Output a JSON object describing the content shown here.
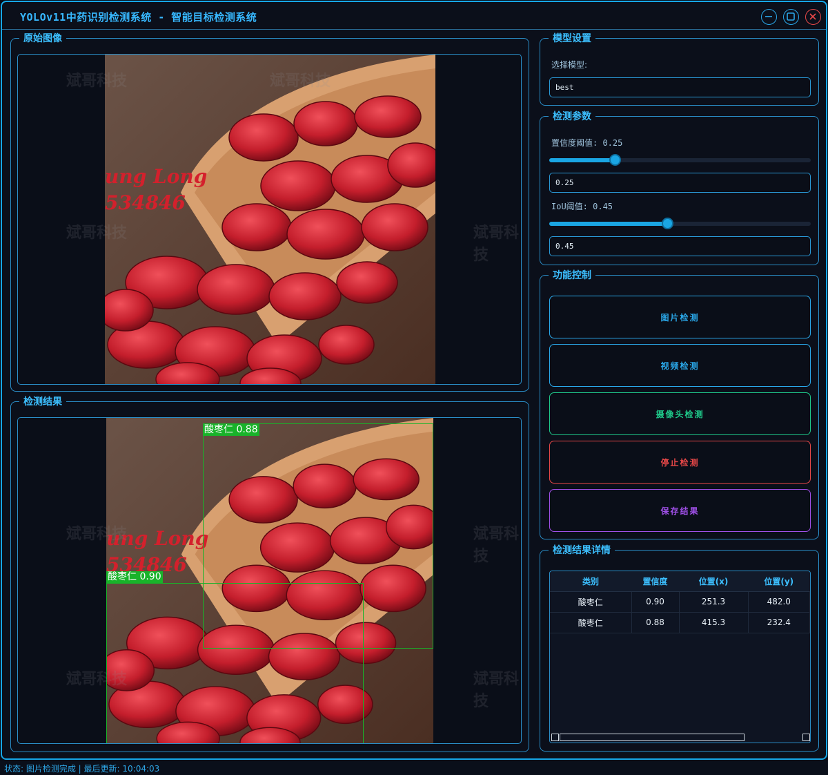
{
  "window": {
    "title": "YOLOv11中药识别检测系统 - 智能目标检测系统",
    "accent": "#16a6e6"
  },
  "panels": {
    "original_title": "原始图像",
    "result_title": "检测结果",
    "photo_text_line1": "ung Long",
    "photo_text_line2": "534846",
    "watermark": "斌哥科技"
  },
  "detections_overlay": [
    {
      "label": "酸枣仁 0.88"
    },
    {
      "label": "酸枣仁 0.90"
    }
  ],
  "model_settings": {
    "title": "模型设置",
    "select_label": "选择模型:",
    "selected_model": "best"
  },
  "detect_params": {
    "title": "检测参数",
    "conf_label": "置信度阈值: 0.25",
    "conf_value": "0.25",
    "conf_level": 0.25,
    "iou_label": "IoU阈值: 0.45",
    "iou_value": "0.45",
    "iou_level": 0.45
  },
  "controls": {
    "title": "功能控制",
    "buttons": [
      {
        "label": "图片检测",
        "color": "#2aa8ea"
      },
      {
        "label": "视频检测",
        "color": "#2aa8ea"
      },
      {
        "label": "摄像头检测",
        "color": "#1fc98a"
      },
      {
        "label": "停止检测",
        "color": "#e84848"
      },
      {
        "label": "保存结果",
        "color": "#a050e8"
      }
    ]
  },
  "results": {
    "title": "检测结果详情",
    "columns": [
      "类别",
      "置信度",
      "位置(x)",
      "位置(y)"
    ],
    "rows": [
      [
        "酸枣仁",
        "0.90",
        "251.3",
        "482.0"
      ],
      [
        "酸枣仁",
        "0.88",
        "415.3",
        "232.4"
      ]
    ]
  },
  "status": {
    "text": "状态: 图片检测完成 | 最后更新: 10:04:03"
  }
}
